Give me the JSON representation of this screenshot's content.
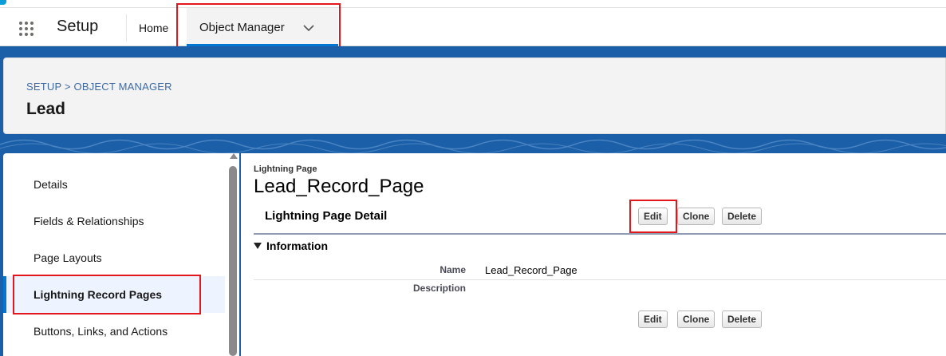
{
  "nav": {
    "app_name": "Setup",
    "home_label": "Home",
    "object_manager_label": "Object Manager"
  },
  "header": {
    "breadcrumb": "SETUP > OBJECT MANAGER",
    "object_title": "Lead"
  },
  "sidebar": {
    "items": [
      {
        "label": "Details"
      },
      {
        "label": "Fields & Relationships"
      },
      {
        "label": "Page Layouts"
      },
      {
        "label": "Lightning Record Pages"
      },
      {
        "label": "Buttons, Links, and Actions"
      }
    ],
    "active_index": 3
  },
  "main": {
    "page_type_label": "Lightning Page",
    "page_name": "Lead_Record_Page",
    "detail_title": "Lightning Page Detail",
    "buttons": {
      "edit": "Edit",
      "clone": "Clone",
      "delete": "Delete"
    },
    "section_title": "Information",
    "fields": [
      {
        "label": "Name",
        "value": "Lead_Record_Page"
      },
      {
        "label": "Description",
        "value": ""
      }
    ]
  },
  "colors": {
    "brand_band": "#1b5fa8",
    "accent": "#0176d3",
    "highlight": "#e3161b"
  },
  "icons": [
    "app-launcher-icon",
    "chevron-down-icon",
    "collapse-triangle-icon",
    "scroll-up-arrow-icon"
  ]
}
